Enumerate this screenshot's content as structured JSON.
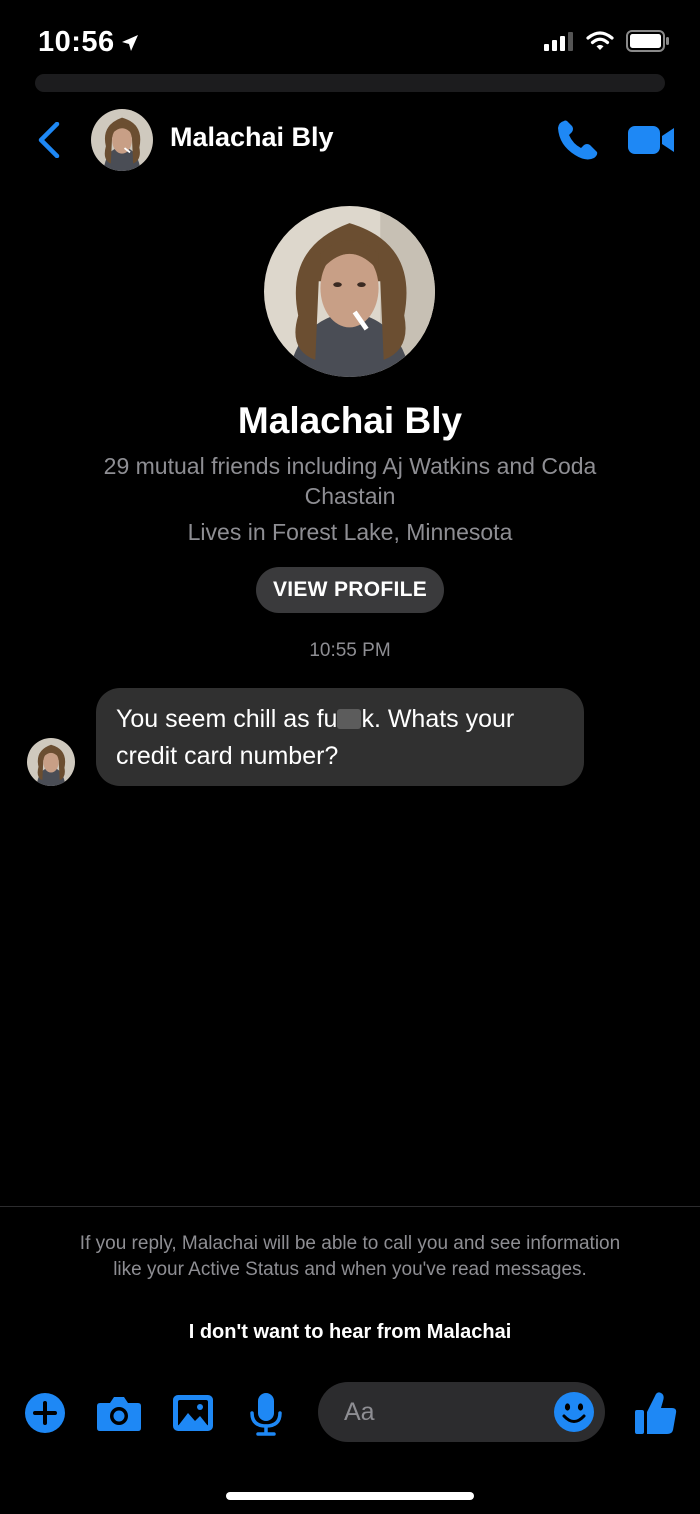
{
  "status_bar": {
    "time": "10:56"
  },
  "header": {
    "name": "Malachai Bly"
  },
  "profile": {
    "name": "Malachai Bly",
    "mutual_friends": "29 mutual friends including Aj Watkins and Coda Chastain",
    "location": "Lives in Forest Lake, Minnesota",
    "view_profile_label": "VIEW PROFILE"
  },
  "conversation": {
    "timestamp": "10:55 PM",
    "message": {
      "pre": "You seem chill as fu",
      "post": "k. Whats your credit card number?"
    }
  },
  "request_notice": {
    "text": "If you reply, Malachai will be able to call you and see information like your Active Status and when you've read messages.",
    "block_label": "I don't want to hear from Malachai"
  },
  "composer": {
    "placeholder": "Aa"
  },
  "colors": {
    "accent": "#1e88f5",
    "bubble": "#303030",
    "secondary_text": "#8e8e93",
    "button": "#3a3a3c"
  },
  "icons": [
    "location-arrow-icon",
    "signal-icon",
    "wifi-icon",
    "battery-icon",
    "back-chevron-icon",
    "phone-icon",
    "video-camera-icon",
    "plus-icon",
    "camera-icon",
    "image-icon",
    "microphone-icon",
    "emoji-icon",
    "thumbs-up-icon"
  ]
}
